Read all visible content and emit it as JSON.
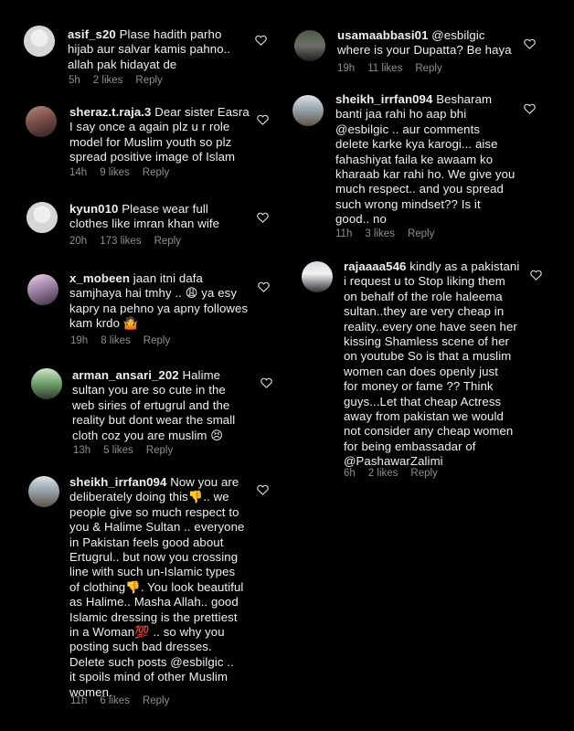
{
  "left": [
    {
      "user": "asif_s20",
      "text": " Plase hadith parho\nhijab aur salvar kamis pahno..\nallah pak hidayat de",
      "time": "5h",
      "likes": "2 likes",
      "reply": "Reply"
    },
    {
      "user": "sheraz.t.raja.3",
      "text": " Dear sister Easra\nI say once a again plz u r role\nmodel for Muslim youth so plz\nspread positive image of Islam",
      "time": "14h",
      "likes": "9 likes",
      "reply": "Reply"
    },
    {
      "user": "kyun010",
      "text": " Please wear full\nclothes like imran khan wife",
      "time": "20h",
      "likes": "173 likes",
      "reply": "Reply"
    },
    {
      "user": "x_mobeen",
      "text": " jaan itni dafa\nsamjhaya hai tmhy .. 😩 ya esy\nkapry na pehno ya apny followes\nkam krdo 🤷",
      "time": "19h",
      "likes": "8 likes",
      "reply": "Reply"
    },
    {
      "user": "arman_ansari_202",
      "text": " Halime\nsultan you are so cute in the\nweb siries of ertugrul and the\nreality but dont wear the small\ncloth coz you are muslim 😣",
      "time": "13h",
      "likes": "5 likes",
      "reply": "Reply"
    },
    {
      "user": "sheikh_irrfan094",
      "text": " Now you are\ndeliberately doing this👎.. we\npeople give so much respect to\nyou & Halime Sultan .. everyone\nin Pakistan feels good about\nErtugrul.. but now you crossing\nline with such un-Islamic types\nof clothing👎. You look beautiful\nas Halime.. Masha Allah.. good\nIslamic dressing is the prettiest\nin a Woman💯 .. so why you\nposting such bad dresses.\nDelete such posts @esbilgic ..\nit spoils mind of other Muslim\nwomen.",
      "time": "11h",
      "likes": "6 likes",
      "reply": "Reply"
    }
  ],
  "right": [
    {
      "user": "usamaabbasi01",
      "text": " @esbilgic\nwhere is your Dupatta? Be haya",
      "time": "19h",
      "likes": "11 likes",
      "reply": "Reply"
    },
    {
      "user": "sheikh_irrfan094",
      "text": " Besharam\nbanti jaa rahi ho aap bhi\n@esbilgic .. aur comments\ndelete karke kya karogi... aise\nfahashiyat faila ke awaam ko\nkharaab kar rahi ho. We give you\nmuch respect.. and you spread\nsuch wrong mindset?? Is it\ngood.. no",
      "time": "11h",
      "likes": "3 likes",
      "reply": "Reply"
    },
    {
      "user": "rajaaaa546",
      "text": " kindly as a pakistani\ni request u to Stop liking them\non behalf of the role haleema\nsultan..they are very cheap in\nreality..every one have seen her\nkissing Shamless scene of her\non youtube So is that a muslim\nwomen can does openly just\nfor money or fame ?? Think\nguys...Let that cheap Actress\naway from pakistan we would\nnot consider any cheap women\nfor being embassadar of\n@PashawarZalimi",
      "time": "6h",
      "likes": "2 likes",
      "reply": "Reply"
    }
  ],
  "icons": {
    "avatar": "profile-avatar",
    "like": "heart-outline-icon"
  }
}
